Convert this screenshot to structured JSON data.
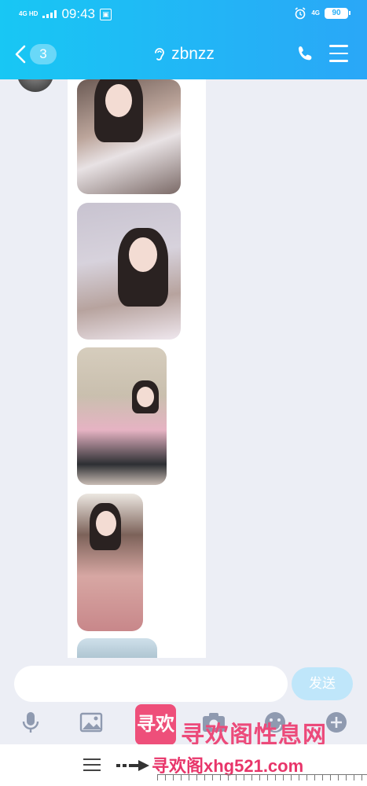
{
  "status_bar": {
    "network": "4G HD",
    "time": "09:43",
    "sim_icon": "sim-card-icon",
    "alarm_icon": "alarm-clock-icon",
    "network_right": "4G",
    "battery": "90"
  },
  "header": {
    "unread_count": "3",
    "contact_name": "zbnzz",
    "earpiece_icon": "ear-icon",
    "call_icon": "phone-icon",
    "menu_icon": "menu-icon",
    "background_colors": [
      "#18c7f4",
      "#2aa7f7"
    ]
  },
  "chat": {
    "image_messages": 5
  },
  "input": {
    "placeholder": "",
    "send_label": "发送",
    "send_color": "#bfe6fa"
  },
  "toolbar": {
    "items": [
      "mic-icon",
      "image-icon",
      "camera-icon",
      "emoji-icon",
      "plus-icon"
    ]
  },
  "watermark": {
    "logo_text": "寻欢",
    "title": "寻欢阁性息网",
    "url": "寻欢阁xhg521.com"
  }
}
